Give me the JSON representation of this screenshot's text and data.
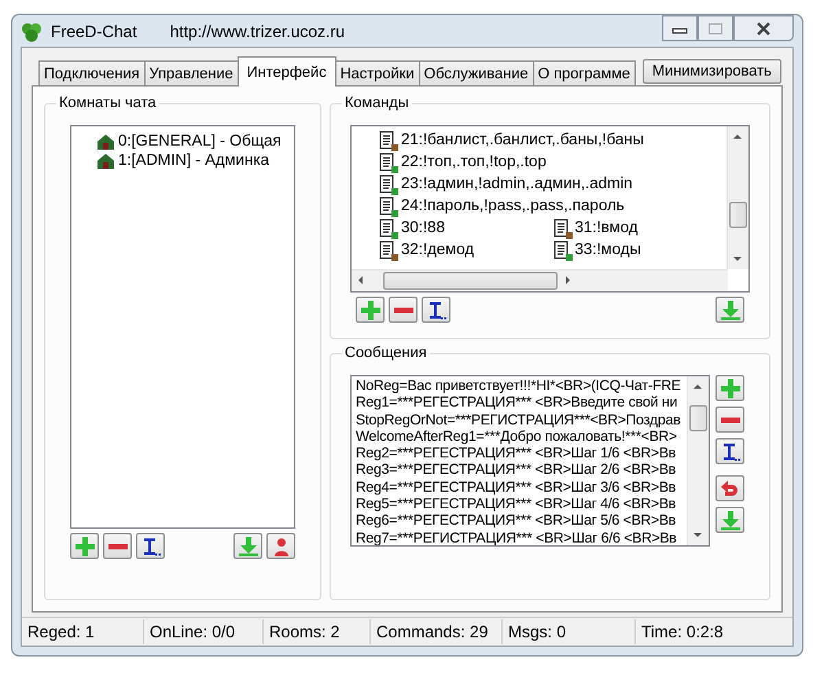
{
  "window": {
    "title": "FreeD-Chat",
    "url": "http://www.trizer.ucoz.ru"
  },
  "tabs": [
    {
      "label": "Подключения",
      "selected": false
    },
    {
      "label": "Управление",
      "selected": false
    },
    {
      "label": "Интерфейс",
      "selected": true
    },
    {
      "label": "Настройки",
      "selected": false
    },
    {
      "label": "Обслуживание",
      "selected": false
    },
    {
      "label": "О программе",
      "selected": false
    }
  ],
  "minimize_button": "Минимизировать",
  "rooms": {
    "title": "Комнаты чата",
    "items": [
      {
        "label": "0:[GENERAL] - Общая"
      },
      {
        "label": "1:[ADMIN] - Админка"
      }
    ],
    "buttons": [
      {
        "kind": "add"
      },
      {
        "kind": "remove"
      },
      {
        "kind": "rename"
      },
      {
        "kind": "gap"
      },
      {
        "kind": "download"
      },
      {
        "kind": "user"
      }
    ]
  },
  "commands": {
    "title": "Команды",
    "items": [
      {
        "label": "21:!банлист,.банлист,.баны,!баны",
        "color": "#8a5a2a"
      },
      {
        "label": "22:!топ,.топ,!top,.top",
        "color": "#2f9e3a"
      },
      {
        "label": "23:!админ,!admin,.админ,.admin",
        "color": "#2f9e3a"
      },
      {
        "label": "24:!пароль,!pass,.pass,.пароль",
        "color": "#2f9e3a"
      },
      {
        "label": "30:!88",
        "color": "#2f9e3a"
      },
      {
        "label": "31:!вмод",
        "color": "#8a5a2a"
      },
      {
        "label": "32:!демод",
        "color": "#8a5a2a"
      },
      {
        "label": "33:!моды",
        "color": "#2f9e3a"
      }
    ],
    "buttons": [
      {
        "kind": "add"
      },
      {
        "kind": "remove"
      },
      {
        "kind": "rename"
      },
      {
        "kind": "gap"
      },
      {
        "kind": "download"
      }
    ]
  },
  "messages": {
    "title": "Сообщения",
    "items": [
      "NoReg=Вас приветствует!!!*HI*<BR>(ICQ-Чат-FRE",
      "Reg1=***РЕГЕСТРАЦИЯ*** <BR>Введите свой ни",
      "StopRegOrNot=***РЕГИСТРАЦИЯ***<BR>Поздрав",
      "WelcomeAfterReg1=***Добро пожаловать!***<BR>",
      "Reg2=***РЕГЕСТРАЦИЯ*** <BR>Шаг 1/6 <BR>Вв",
      "Reg3=***РЕГЕСТРАЦИЯ*** <BR>Шаг 2/6 <BR>Вв",
      "Reg4=***РЕГЕСТРАЦИЯ*** <BR>Шаг 3/6 <BR>Вв",
      "Reg5=***РЕГЕСТРАЦИЯ*** <BR>Шаг 4/6 <BR>Вв",
      "Reg6=***РЕГЕСТРАЦИЯ*** <BR>Шаг 5/6 <BR>Вв",
      "Reg7=***РЕГИСТРАЦИЯ*** <BR>Шаг 6/6 <BR>Вв"
    ],
    "buttons": [
      {
        "kind": "add"
      },
      {
        "kind": "remove"
      },
      {
        "kind": "rename"
      },
      {
        "kind": "undo"
      },
      {
        "kind": "download"
      }
    ]
  },
  "status_bar": [
    "Reged: 1",
    "OnLine: 0/0",
    "Rooms: 2",
    "Commands: 29",
    "Msgs: 0",
    "Time: 0:2:8"
  ]
}
